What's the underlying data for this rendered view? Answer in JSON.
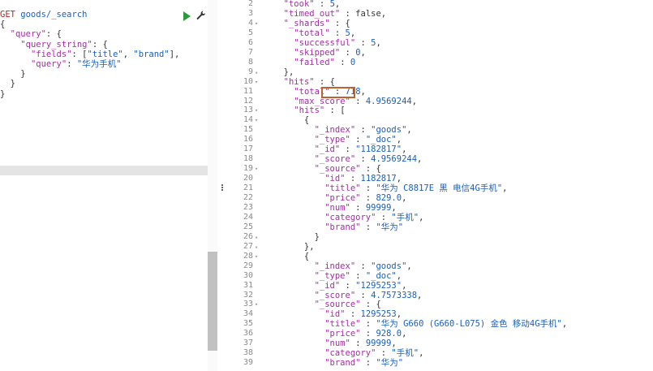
{
  "request": {
    "method": "GET",
    "url": "goods/_search",
    "body_lines": [
      "{",
      "  \"query\": {",
      "    \"query_string\": {",
      "      \"fields\": [\"title\", \"brand\"],",
      "      \"query\": \"华为手机\"",
      "    }",
      "  }",
      "}"
    ]
  },
  "toolbar": {
    "run_icon": "play-icon",
    "settings_icon": "wrench-icon",
    "run_color": "#2b9b3e"
  },
  "response": {
    "highlight_color": "#c0622d",
    "lines": [
      {
        "n": "2",
        "fold": "",
        "text": "  \"took\" : 5,"
      },
      {
        "n": "3",
        "fold": "",
        "text": "  \"timed_out\" : false,"
      },
      {
        "n": "4",
        "fold": "▾",
        "text": "  \"_shards\" : {"
      },
      {
        "n": "5",
        "fold": "",
        "text": "    \"total\" : 5,"
      },
      {
        "n": "6",
        "fold": "",
        "text": "    \"successful\" : 5,"
      },
      {
        "n": "7",
        "fold": "",
        "text": "    \"skipped\" : 0,"
      },
      {
        "n": "8",
        "fold": "",
        "text": "    \"failed\" : 0"
      },
      {
        "n": "9",
        "fold": "▴",
        "text": "  },"
      },
      {
        "n": "10",
        "fold": "▾",
        "text": "  \"hits\" : {"
      },
      {
        "n": "11",
        "fold": "",
        "text": "    \"total\" : 718,"
      },
      {
        "n": "12",
        "fold": "",
        "text": "    \"max_score\" : 4.9569244,"
      },
      {
        "n": "13",
        "fold": "▾",
        "text": "    \"hits\" : ["
      },
      {
        "n": "14",
        "fold": "▾",
        "text": "      {"
      },
      {
        "n": "15",
        "fold": "",
        "text": "        \"_index\" : \"goods\","
      },
      {
        "n": "16",
        "fold": "",
        "text": "        \"_type\" : \"_doc\","
      },
      {
        "n": "17",
        "fold": "",
        "text": "        \"_id\" : \"1182817\","
      },
      {
        "n": "18",
        "fold": "",
        "text": "        \"_score\" : 4.9569244,"
      },
      {
        "n": "19",
        "fold": "▾",
        "text": "        \"_source\" : {"
      },
      {
        "n": "20",
        "fold": "",
        "text": "          \"id\" : 1182817,"
      },
      {
        "n": "21",
        "fold": "",
        "text": "          \"title\" : \"华为 C8817E 黑 电信4G手机\","
      },
      {
        "n": "22",
        "fold": "",
        "text": "          \"price\" : 829.0,"
      },
      {
        "n": "23",
        "fold": "",
        "text": "          \"num\" : 99999,"
      },
      {
        "n": "24",
        "fold": "",
        "text": "          \"category\" : \"手机\","
      },
      {
        "n": "25",
        "fold": "",
        "text": "          \"brand\" : \"华为\""
      },
      {
        "n": "26",
        "fold": "▴",
        "text": "        }"
      },
      {
        "n": "27",
        "fold": "▴",
        "text": "      },"
      },
      {
        "n": "28",
        "fold": "▾",
        "text": "      {"
      },
      {
        "n": "29",
        "fold": "",
        "text": "        \"_index\" : \"goods\","
      },
      {
        "n": "30",
        "fold": "",
        "text": "        \"_type\" : \"_doc\","
      },
      {
        "n": "31",
        "fold": "",
        "text": "        \"_id\" : \"1295253\","
      },
      {
        "n": "32",
        "fold": "",
        "text": "        \"_score\" : 4.7573338,"
      },
      {
        "n": "33",
        "fold": "▾",
        "text": "        \"_source\" : {"
      },
      {
        "n": "34",
        "fold": "",
        "text": "          \"id\" : 1295253,"
      },
      {
        "n": "35",
        "fold": "",
        "text": "          \"title\" : \"华为 G660 (G660-L075) 金色 移动4G手机\","
      },
      {
        "n": "36",
        "fold": "",
        "text": "          \"price\" : 928.0,"
      },
      {
        "n": "37",
        "fold": "",
        "text": "          \"num\" : 99999,"
      },
      {
        "n": "38",
        "fold": "",
        "text": "          \"category\" : \"手机\","
      },
      {
        "n": "39",
        "fold": "",
        "text": "          \"brand\" : \"华为\""
      }
    ]
  }
}
